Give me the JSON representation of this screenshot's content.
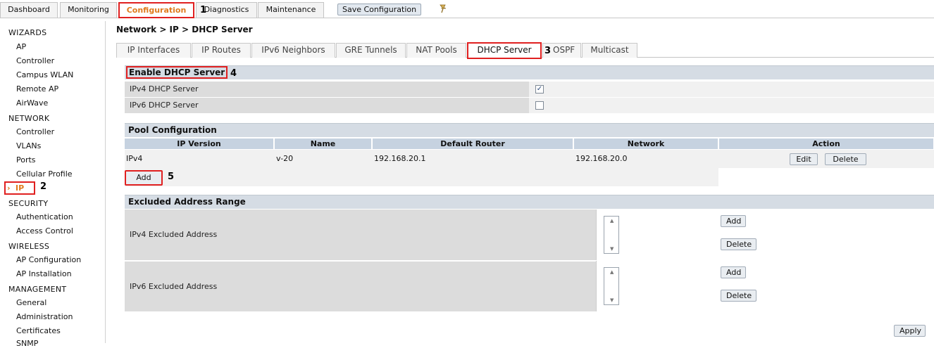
{
  "topnav": {
    "tabs": [
      {
        "label": "Dashboard"
      },
      {
        "label": "Monitoring"
      },
      {
        "label": "Configuration"
      },
      {
        "label": "Diagnostics"
      },
      {
        "label": "Maintenance"
      }
    ],
    "save_label": "Save Configuration"
  },
  "markers": [
    "1",
    "2",
    "3",
    "4",
    "5"
  ],
  "sidebar": {
    "sections": [
      {
        "label": "WIZARDS",
        "items": [
          "AP",
          "Controller",
          "Campus WLAN",
          "Remote AP",
          "AirWave"
        ]
      },
      {
        "label": "NETWORK",
        "items": [
          "Controller",
          "VLANs",
          "Ports",
          "Cellular Profile"
        ]
      },
      {
        "label": "SECURITY",
        "items": [
          "Authentication",
          "Access Control"
        ]
      },
      {
        "label": "WIRELESS",
        "items": [
          "AP Configuration",
          "AP Installation"
        ]
      },
      {
        "label": "MANAGEMENT",
        "items": [
          "General",
          "Administration",
          "Certificates",
          "SNMP"
        ]
      }
    ],
    "active_item": "IP"
  },
  "breadcrumb": "Network > IP > DHCP Server",
  "subtabs": [
    "IP Interfaces",
    "IP Routes",
    "IPv6 Neighbors",
    "GRE Tunnels",
    "NAT Pools",
    "DHCP Server",
    "OSPF",
    "Multicast"
  ],
  "enable_dhcp": {
    "title": "Enable DHCP Server",
    "rows": [
      {
        "label": "IPv4 DHCP Server",
        "checked": true
      },
      {
        "label": "IPv6 DHCP Server",
        "checked": false
      }
    ]
  },
  "pool": {
    "title": "Pool Configuration",
    "columns": [
      "IP Version",
      "Name",
      "Default Router",
      "Network",
      "Action"
    ],
    "rows": [
      {
        "ip_version": "IPv4",
        "name": "v-20",
        "default_router": "192.168.20.1",
        "network": "192.168.20.0"
      }
    ],
    "edit_label": "Edit",
    "delete_label": "Delete",
    "add_label": "Add"
  },
  "excluded": {
    "title": "Excluded Address Range",
    "rows": [
      {
        "label": "IPv4 Excluded Address"
      },
      {
        "label": "IPv6 Excluded Address"
      }
    ],
    "add_label": "Add",
    "delete_label": "Delete"
  },
  "apply_label": "Apply",
  "colors": {
    "active_orange": "#e07a1c",
    "highlight_red": "#e02020",
    "section_bg": "#d5dce4",
    "table_head_bg": "#c6d2e0"
  }
}
